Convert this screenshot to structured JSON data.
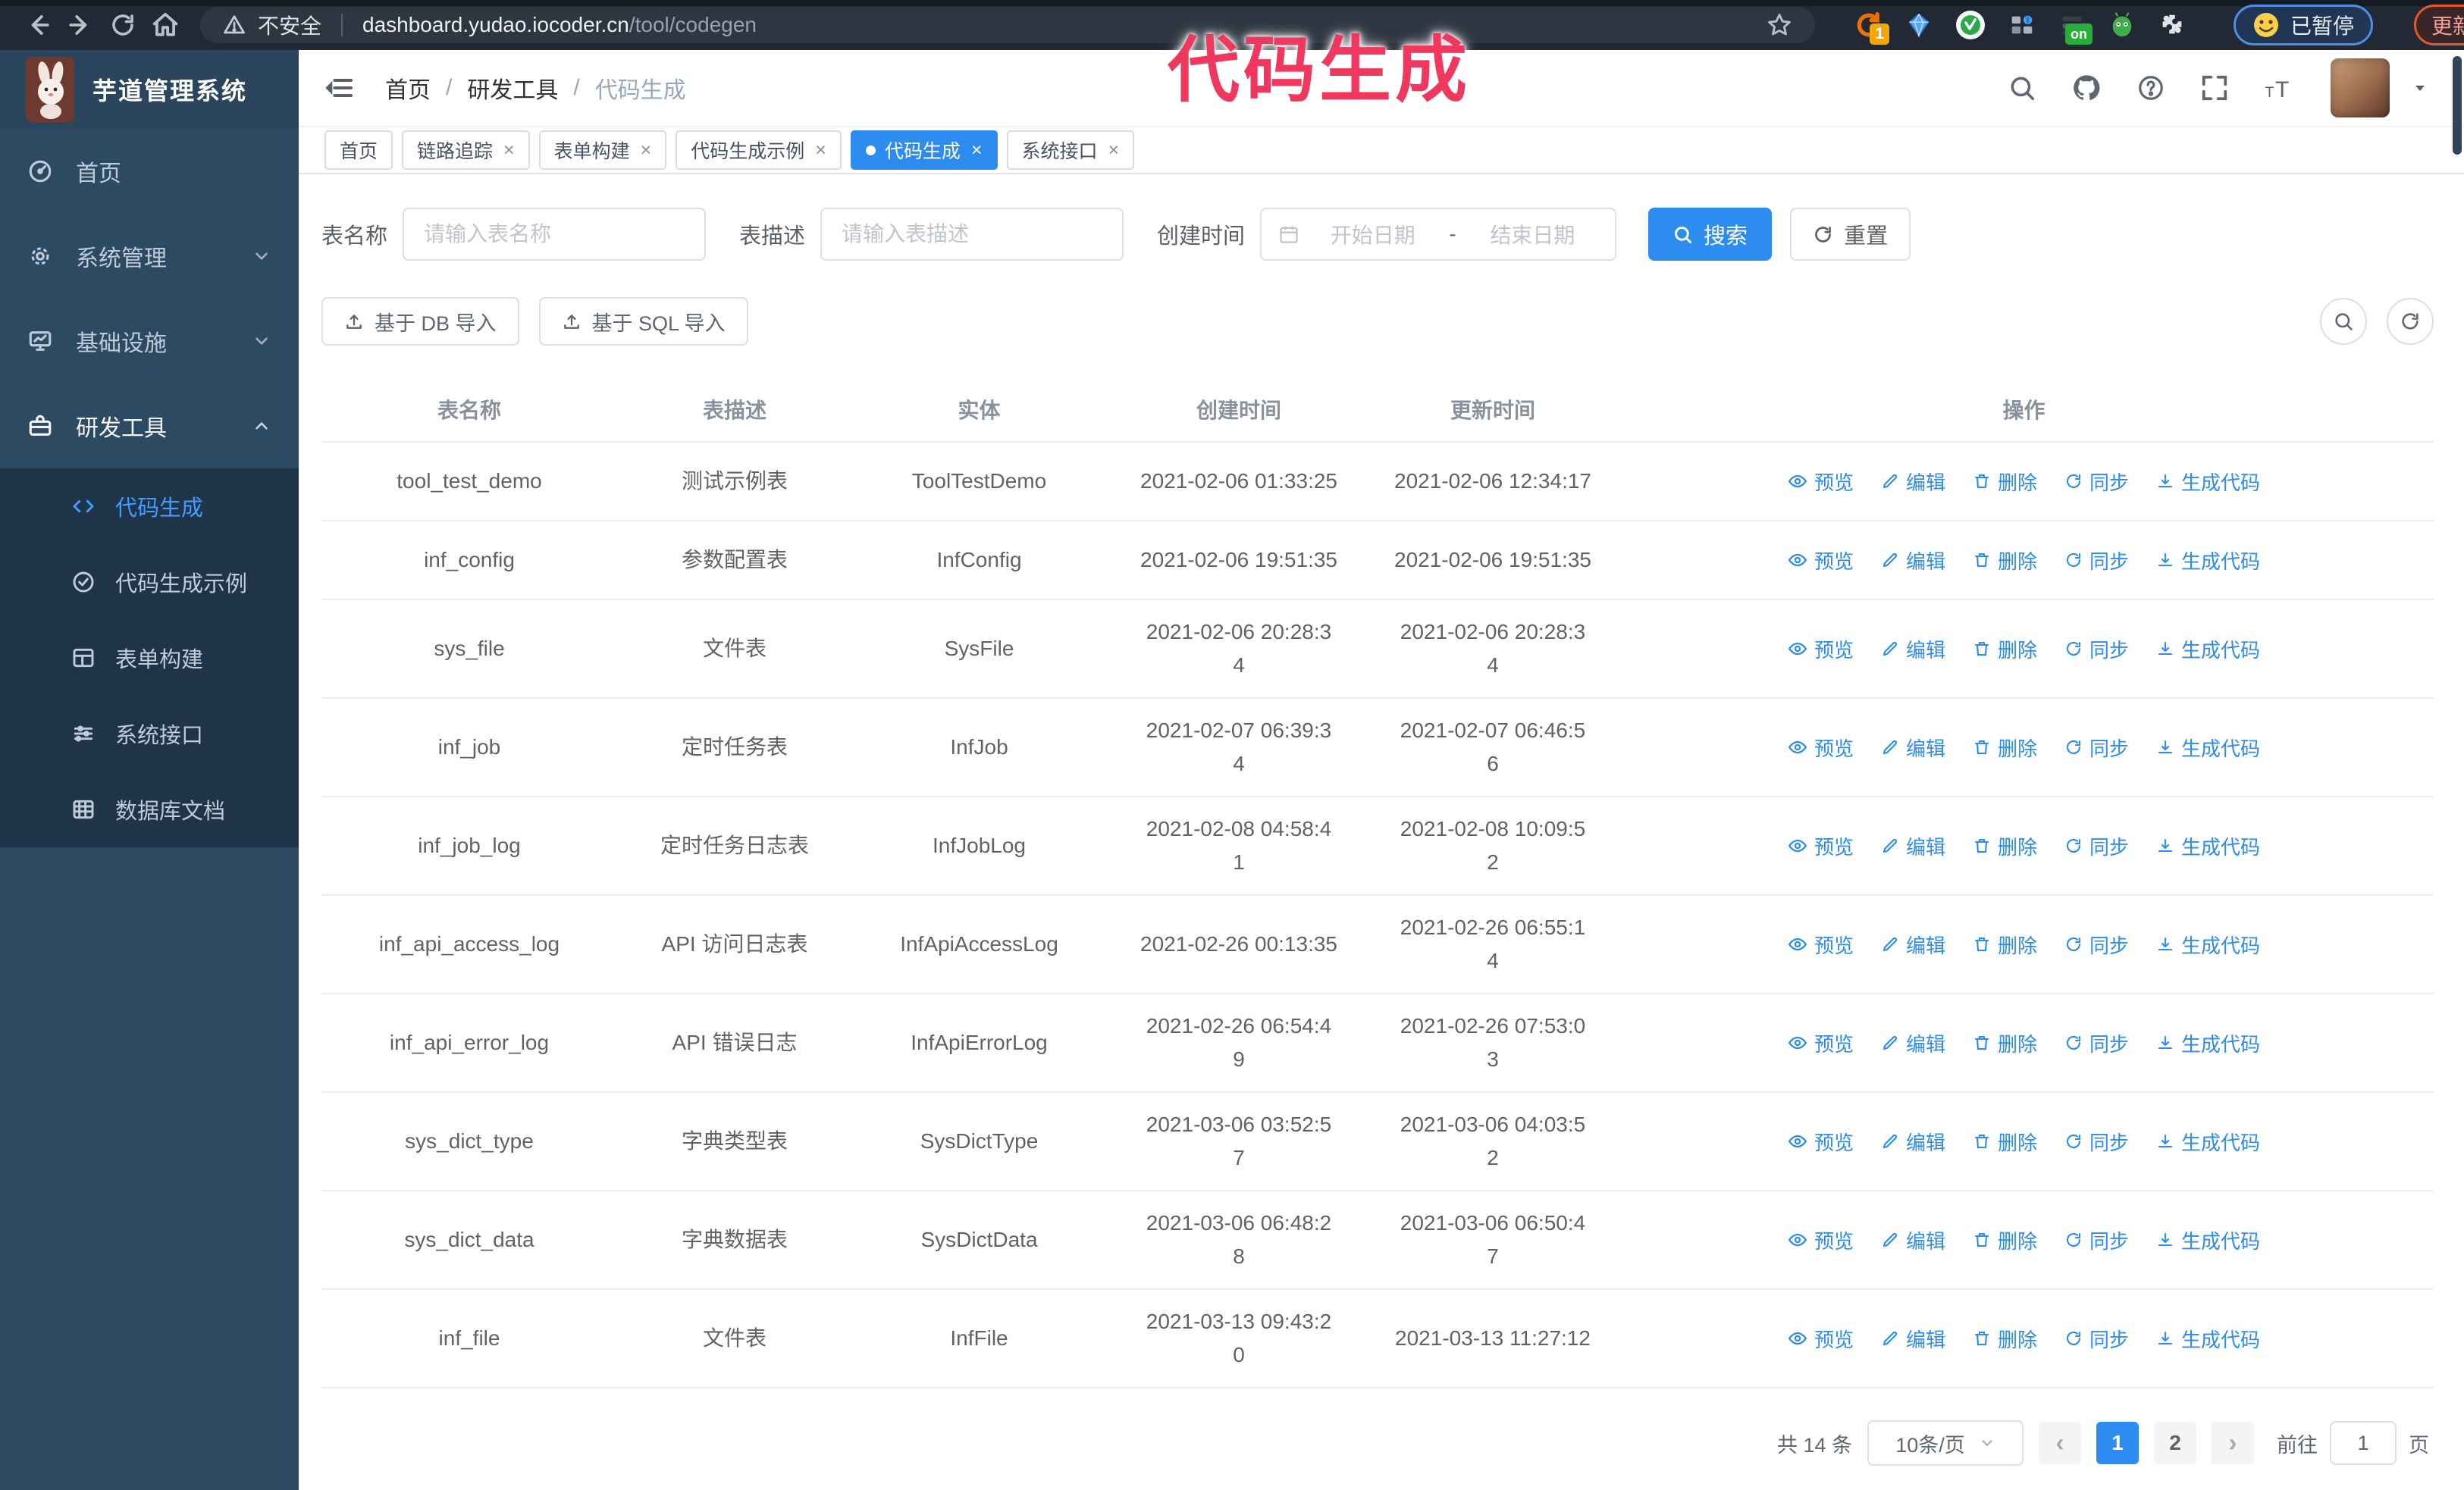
{
  "annotation_text": "代码生成",
  "browser": {
    "security_label": "不安全",
    "url_host": "dashboard.yudao.iocoder.cn",
    "url_path": "/tool/codegen",
    "extension_badge": "1",
    "extension_on_badge": "on",
    "paused_badge": "已暂停",
    "update_label": "更新"
  },
  "icons": {
    "star": "☆",
    "close": "×",
    "prev": "‹",
    "next": "›"
  },
  "app_title": "芋道管理系统",
  "breadcrumb": {
    "separator": "/",
    "items": [
      "首页",
      "研发工具",
      "代码生成"
    ]
  },
  "tabs": [
    {
      "label": "首页"
    },
    {
      "label": "链路追踪"
    },
    {
      "label": "表单构建"
    },
    {
      "label": "代码生成示例"
    },
    {
      "label": "代码生成"
    },
    {
      "label": "系统接口"
    }
  ],
  "sidebar": {
    "items": [
      {
        "label": "首页"
      },
      {
        "label": "系统管理"
      },
      {
        "label": "基础设施"
      },
      {
        "label": "研发工具"
      }
    ],
    "subitems": [
      {
        "label": "代码生成"
      },
      {
        "label": "代码生成示例"
      },
      {
        "label": "表单构建"
      },
      {
        "label": "系统接口"
      },
      {
        "label": "数据库文档"
      }
    ]
  },
  "filters": {
    "name_label": "表名称",
    "name_placeholder": "请输入表名称",
    "desc_label": "表描述",
    "desc_placeholder": "请输入表描述",
    "time_label": "创建时间",
    "start_placeholder": "开始日期",
    "range_separator": "-",
    "end_placeholder": "结束日期",
    "search_label": "搜索",
    "reset_label": "重置"
  },
  "toolbar": {
    "db_import_label": "基于 DB 导入",
    "sql_import_label": "基于 SQL 导入"
  },
  "table": {
    "columns": [
      "表名称",
      "表描述",
      "实体",
      "创建时间",
      "更新时间",
      "操作"
    ],
    "rows": [
      {
        "name": "tool_test_demo",
        "desc": "测试示例表",
        "entity": "ToolTestDemo",
        "created": "2021-02-06 01:33:25",
        "updated": "2021-02-06 12:34:17"
      },
      {
        "name": "inf_config",
        "desc": "参数配置表",
        "entity": "InfConfig",
        "created": "2021-02-06 19:51:35",
        "updated": "2021-02-06 19:51:35"
      },
      {
        "name": "sys_file",
        "desc": "文件表",
        "entity": "SysFile",
        "created": "2021-02-06 20:28:3\n4",
        "updated": "2021-02-06 20:28:3\n4"
      },
      {
        "name": "inf_job",
        "desc": "定时任务表",
        "entity": "InfJob",
        "created": "2021-02-07 06:39:3\n4",
        "updated": "2021-02-07 06:46:5\n6"
      },
      {
        "name": "inf_job_log",
        "desc": "定时任务日志表",
        "entity": "InfJobLog",
        "created": "2021-02-08 04:58:4\n1",
        "updated": "2021-02-08 10:09:5\n2"
      },
      {
        "name": "inf_api_access_log",
        "desc": "API 访问日志表",
        "entity": "InfApiAccessLog",
        "created": "2021-02-26 00:13:35",
        "updated": "2021-02-26 06:55:1\n4"
      },
      {
        "name": "inf_api_error_log",
        "desc": "API 错误日志",
        "entity": "InfApiErrorLog",
        "created": "2021-02-26 06:54:4\n9",
        "updated": "2021-02-26 07:53:0\n3"
      },
      {
        "name": "sys_dict_type",
        "desc": "字典类型表",
        "entity": "SysDictType",
        "created": "2021-03-06 03:52:5\n7",
        "updated": "2021-03-06 04:03:5\n2"
      },
      {
        "name": "sys_dict_data",
        "desc": "字典数据表",
        "entity": "SysDictData",
        "created": "2021-03-06 06:48:2\n8",
        "updated": "2021-03-06 06:50:4\n7"
      },
      {
        "name": "inf_file",
        "desc": "文件表",
        "entity": "InfFile",
        "created": "2021-03-13 09:43:2\n0",
        "updated": "2021-03-13 11:27:12"
      }
    ]
  },
  "operations": [
    "预览",
    "编辑",
    "删除",
    "同步",
    "生成代码"
  ],
  "pagination": {
    "total": "共 14 条",
    "page_size": "10条/页",
    "prev": "‹",
    "pages": [
      "1",
      "2"
    ],
    "current": "1",
    "next": "›",
    "goto_label": "前往",
    "goto_value": "1",
    "unit_label": "页"
  },
  "colors": {
    "accent": "#2d8cf0",
    "menu_active": "#409eff",
    "annotation": "#f0385f",
    "sidebar_bg": "#2d4a63",
    "submenu_bg": "#1f3349"
  }
}
